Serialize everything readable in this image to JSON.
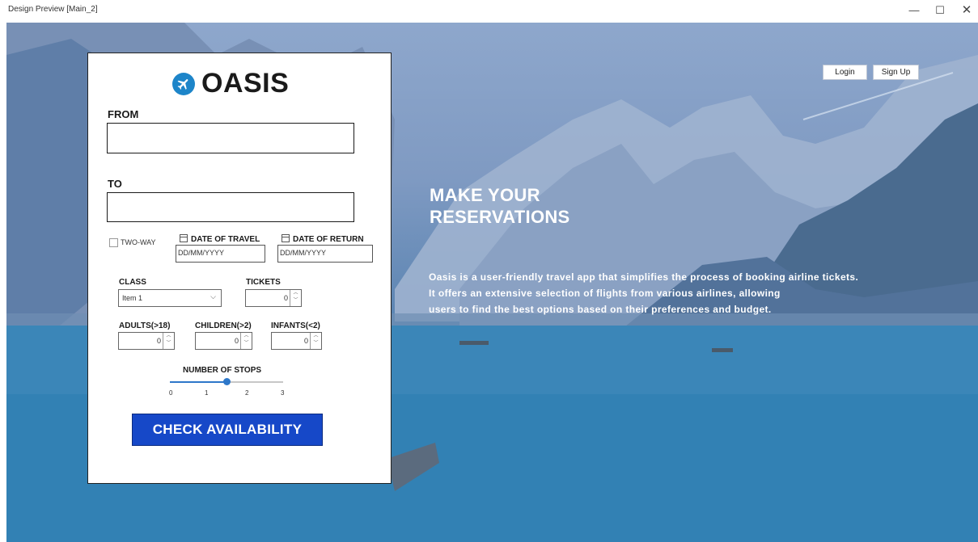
{
  "window": {
    "title": "Design Preview [Main_2]",
    "minimize": "—",
    "maximize": "☐",
    "close": "✕"
  },
  "header": {
    "login_label": "Login",
    "signup_label": "Sign Up"
  },
  "hero": {
    "title": "MAKE YOUR RESERVATIONS",
    "description_lines": [
      "Oasis is a user-friendly travel app that simplifies the process of booking airline tickets.",
      "It offers an extensive selection of flights from various airlines, allowing",
      "users to find the best options based on their preferences and budget."
    ]
  },
  "form": {
    "logo_text": "OASIS",
    "logo_icon": "airplane-icon",
    "from_label": "FROM",
    "from_value": "",
    "to_label": "TO",
    "to_value": "",
    "two_way_label": "TWO-WAY",
    "two_way_checked": false,
    "date_of_travel_label": "DATE OF TRAVEL",
    "date_of_travel_value": "DD/MM/YYYY",
    "date_of_return_label": "DATE OF RETURN",
    "date_of_return_value": "DD/MM/YYYY",
    "class_label": "CLASS",
    "class_value": "Item 1",
    "tickets_label": "TICKETS",
    "tickets_value": "0",
    "adults_label": "ADULTS(>18)",
    "adults_value": "0",
    "children_label": "CHILDREN(>2)",
    "children_value": "0",
    "infants_label": "INFANTS(<2)",
    "infants_value": "0",
    "stops_label": "NUMBER OF STOPS",
    "stops_ticks": [
      "0",
      "1",
      "2",
      "3"
    ],
    "stops_value": 1.5,
    "check_button_label": "CHECK AVAILABILITY"
  },
  "colors": {
    "accent": "#1648c8",
    "slider": "#2d77c9",
    "logo_icon": "#1d85c9"
  }
}
